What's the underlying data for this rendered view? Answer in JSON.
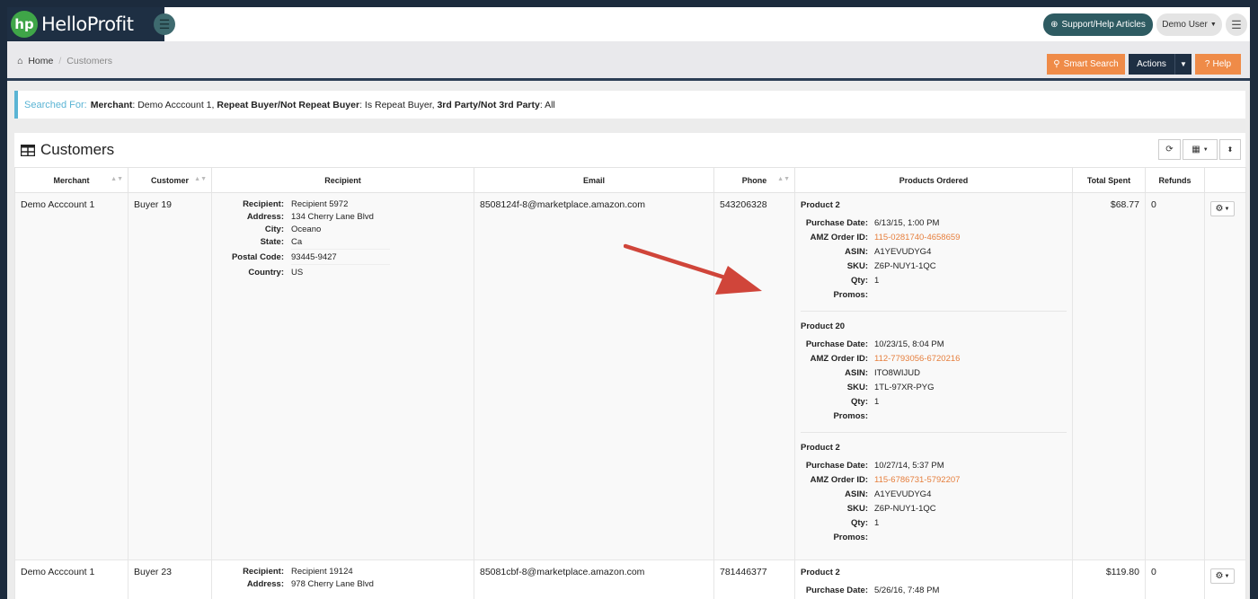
{
  "app": {
    "logo_mark": "hp",
    "name": "HelloProfit",
    "support_label": "Support/Help Articles",
    "user_label": "Demo User"
  },
  "breadcrumb": {
    "home": "Home",
    "current": "Customers"
  },
  "toolbar": {
    "smart_search": "Smart Search",
    "actions": "Actions",
    "help": "Help"
  },
  "search_summary": {
    "label": "Searched For:",
    "f1_key": "Merchant",
    "f1_val": ": Demo Acccount 1, ",
    "f2_key": "Repeat Buyer/Not Repeat Buyer",
    "f2_val": ": Is Repeat Buyer, ",
    "f3_key": "3rd Party/Not 3rd Party",
    "f3_val": ": All"
  },
  "panel": {
    "title": "Customers"
  },
  "columns": [
    "Merchant",
    "Customer",
    "Recipient",
    "Email",
    "Phone",
    "Products Ordered",
    "Total Spent",
    "Refunds"
  ],
  "labels": {
    "recipient": "Recipient:",
    "address": "Address:",
    "city": "City:",
    "state": "State:",
    "postal": "Postal Code:",
    "country": "Country:",
    "purchase_date": "Purchase Date:",
    "amz_order": "AMZ Order ID:",
    "asin": "ASIN:",
    "sku": "SKU:",
    "qty": "Qty:",
    "promos": "Promos:"
  },
  "rows": [
    {
      "merchant": "Demo Acccount 1",
      "customer": "Buyer 19",
      "recipient": "Recipient 5972",
      "address": "134 Cherry Lane Blvd",
      "city": "Oceano",
      "state": "Ca",
      "postal": "93445-9427",
      "country": "US",
      "email": "8508124f-8@marketplace.amazon.com",
      "phone": "543206328",
      "total": "$68.77",
      "refunds": "0",
      "products": [
        {
          "name": "Product 2",
          "date": "6/13/15, 1:00 PM",
          "order": "115-0281740-4658659",
          "asin": "A1YEVUDYG4",
          "sku": "Z6P-NUY1-1QC",
          "qty": "1",
          "promos": ""
        },
        {
          "name": "Product 20",
          "date": "10/23/15, 8:04 PM",
          "order": "112-7793056-6720216",
          "asin": "ITO8WIJUD",
          "sku": "1TL-97XR-PYG",
          "qty": "1",
          "promos": ""
        },
        {
          "name": "Product 2",
          "date": "10/27/14, 5:37 PM",
          "order": "115-6786731-5792207",
          "asin": "A1YEVUDYG4",
          "sku": "Z6P-NUY1-1QC",
          "qty": "1",
          "promos": ""
        }
      ]
    },
    {
      "merchant": "Demo Acccount 1",
      "customer": "Buyer 23",
      "recipient": "Recipient 19124",
      "address": "978 Cherry Lane Blvd",
      "email": "85081cbf-8@marketplace.amazon.com",
      "phone": "781446377",
      "total": "$119.80",
      "refunds": "0",
      "products": [
        {
          "name": "Product 2",
          "date": "5/26/16, 7:48 PM"
        }
      ]
    }
  ],
  "colors": {
    "brand_dark": "#1e2f43",
    "accent_orange": "#ef8b48",
    "link_orange": "#e67e3c",
    "info_blue": "#5ab4d4",
    "annotation_arrow": "#d0453a"
  }
}
